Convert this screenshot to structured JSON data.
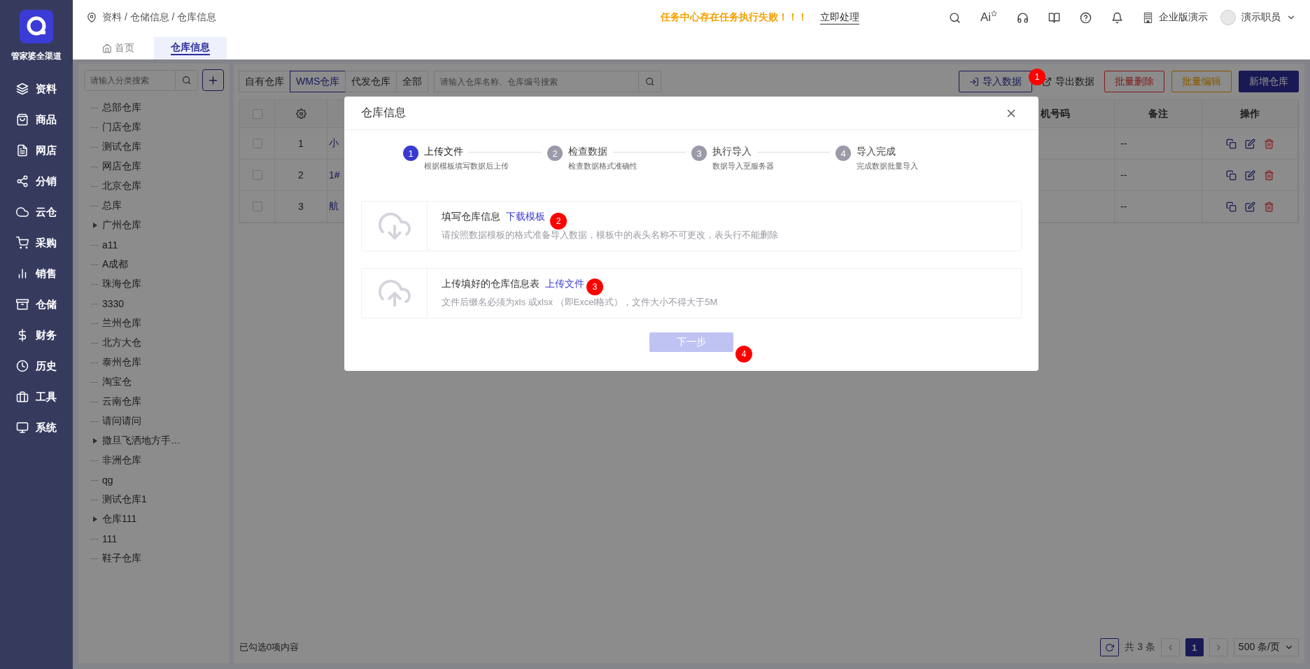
{
  "sidebar": {
    "logo_text": "管家婆全渠道",
    "items": [
      {
        "label": "资料"
      },
      {
        "label": "商品"
      },
      {
        "label": "网店"
      },
      {
        "label": "分销"
      },
      {
        "label": "云仓"
      },
      {
        "label": "采购"
      },
      {
        "label": "销售"
      },
      {
        "label": "仓储"
      },
      {
        "label": "财务"
      },
      {
        "label": "历史"
      },
      {
        "label": "工具"
      },
      {
        "label": "系统"
      }
    ]
  },
  "header": {
    "breadcrumb": "资料 / 仓储信息 / 仓库信息",
    "alert": "任务中心存在任务执行失败！！！",
    "alert_action": "立即处理",
    "ai_label": "Ai",
    "company": "企业版演示",
    "user": "演示职员"
  },
  "tabs": [
    {
      "label": "首页",
      "selected": false
    },
    {
      "label": "仓库信息",
      "selected": true
    }
  ],
  "tree": {
    "placeholder": "请输入分类搜索",
    "items": [
      {
        "label": "总部仓库",
        "kind": "leaf"
      },
      {
        "label": "门店仓库",
        "kind": "leaf"
      },
      {
        "label": "测试仓库",
        "kind": "leaf"
      },
      {
        "label": "网店仓库",
        "kind": "leaf"
      },
      {
        "label": "北京仓库",
        "kind": "leaf"
      },
      {
        "label": "总库",
        "kind": "leaf"
      },
      {
        "label": "广州仓库",
        "kind": "folder"
      },
      {
        "label": "a11",
        "kind": "leaf"
      },
      {
        "label": "A成都",
        "kind": "leaf"
      },
      {
        "label": "珠海仓库",
        "kind": "leaf"
      },
      {
        "label": "3330",
        "kind": "leaf"
      },
      {
        "label": "兰州仓库",
        "kind": "leaf"
      },
      {
        "label": "北方大仓",
        "kind": "leaf"
      },
      {
        "label": "泰州仓库",
        "kind": "leaf"
      },
      {
        "label": "淘宝仓",
        "kind": "leaf"
      },
      {
        "label": "云南仓库",
        "kind": "leaf"
      },
      {
        "label": "请问请问",
        "kind": "leaf"
      },
      {
        "label": "撒旦飞洒地方手…",
        "kind": "folder"
      },
      {
        "label": "非洲仓库",
        "kind": "leaf"
      },
      {
        "label": "qg",
        "kind": "leaf"
      },
      {
        "label": "测试仓库1",
        "kind": "leaf"
      },
      {
        "label": "仓库111",
        "kind": "folder"
      },
      {
        "label": "111",
        "kind": "leaf"
      },
      {
        "label": "鞋子仓库",
        "kind": "leaf"
      }
    ]
  },
  "filters": [
    {
      "label": "自有仓库",
      "selected": false
    },
    {
      "label": "WMS仓库",
      "selected": true
    },
    {
      "label": "代发仓库",
      "selected": false
    },
    {
      "label": "全部",
      "selected": false
    }
  ],
  "search": {
    "placeholder": "请输入仓库名称、仓库编号搜索"
  },
  "actions": [
    {
      "label": "导入数据",
      "kind": "import"
    },
    {
      "label": "导出数据",
      "kind": "export"
    },
    {
      "label": "批量删除",
      "kind": "danger"
    },
    {
      "label": "批量编辑",
      "kind": "warning"
    },
    {
      "label": "新增仓库",
      "kind": "primary"
    }
  ],
  "table": {
    "select_all_checked": false,
    "columns": [
      "机号码",
      "备注",
      "操作"
    ],
    "rows": [
      {
        "checked": false,
        "index": "1",
        "name": "小",
        "remark": "--"
      },
      {
        "checked": false,
        "index": "2",
        "name": "1#",
        "remark": "--"
      },
      {
        "checked": false,
        "index": "3",
        "name": "航",
        "remark": "--"
      }
    ]
  },
  "footer": {
    "selected_text": "已勾选0项内容",
    "total": "共 3 条",
    "page": "1",
    "page_size": "500 条/页"
  },
  "modal": {
    "title": "仓库信息",
    "steps": [
      {
        "number": "1",
        "title": "上传文件",
        "desc": "根据模板填写数据后上传",
        "selected": true
      },
      {
        "number": "2",
        "title": "检查数据",
        "desc": "检查数据格式准确性",
        "selected": false
      },
      {
        "number": "3",
        "title": "执行导入",
        "desc": "数据导入至服务器",
        "selected": false
      },
      {
        "number": "4",
        "title": "导入完成",
        "desc": "完成数据批量导入",
        "selected": false
      }
    ],
    "cards": [
      {
        "kind": "download",
        "title": "填写仓库信息",
        "link": "下载模板",
        "hint": "请按照数据模板的格式准备导入数据，模板中的表头名称不可更改，表头行不能删除"
      },
      {
        "kind": "upload",
        "title": "上传填好的仓库信息表",
        "link": "上传文件",
        "hint": "文件后缀名必须为xls 或xlsx （即Excel格式），文件大小不得大于5M"
      }
    ],
    "next_button": {
      "label": "下一步",
      "disabled": true
    }
  },
  "annotations": [
    "1",
    "2",
    "3",
    "4"
  ]
}
